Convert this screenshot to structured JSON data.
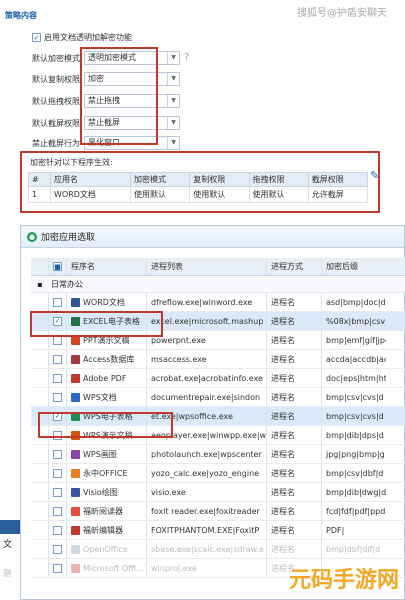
{
  "watermark_top": "搜狐号@护盾安聊天",
  "policy": {
    "section_title": "策略内容",
    "enable_checkbox_label": "启用文档透明加解密功能",
    "fields": [
      {
        "label": "默认加密模式",
        "value": "透明加密模式"
      },
      {
        "label": "默认复制权限",
        "value": "加密"
      },
      {
        "label": "默认拖拽权限",
        "value": "禁止拖拽"
      },
      {
        "label": "默认截屏权限",
        "value": "禁止截屏"
      },
      {
        "label": "禁止截屏行为",
        "value": "黑化窗口"
      }
    ],
    "apply_label": "加密针对以下程序生效:",
    "table": {
      "headers": [
        "#",
        "应用名",
        "加密模式",
        "复制权限",
        "拖拽权限",
        "截屏权限"
      ],
      "rows": [
        [
          "1",
          "WORD文档",
          "使用默认",
          "使用默认",
          "使用默认",
          "允许截屏"
        ]
      ]
    }
  },
  "dialog": {
    "title": "加密应用选取",
    "columns": [
      "程序名",
      "进程列表",
      "进程方式",
      "加密后缀"
    ],
    "group": "日常办公",
    "rows": [
      {
        "checked": false,
        "name": "WORD文档",
        "process": "dfreflow.exe|winword.exe",
        "mode": "进程名",
        "ext": "asd|bmp|doc|do",
        "icon_color": "#2b579a",
        "selected": false,
        "faded": false
      },
      {
        "checked": true,
        "name": "EXCEL电子表格",
        "process": "excel.exe|microsoft.mashup",
        "mode": "进程名",
        "ext": "%08x|bmp|csv|d",
        "icon_color": "#217346",
        "selected": true,
        "faded": false
      },
      {
        "checked": false,
        "name": "PPT演示文稿",
        "process": "powerpnt.exe",
        "mode": "进程名",
        "ext": "bmp|emf|gif|jpe",
        "icon_color": "#d24726",
        "selected": false,
        "faded": false
      },
      {
        "checked": false,
        "name": "Access数据库",
        "process": "msaccess.exe",
        "mode": "进程名",
        "ext": "accda|accdb|ac",
        "icon_color": "#a4373a",
        "selected": false,
        "faded": false
      },
      {
        "checked": false,
        "name": "Adobe PDF",
        "process": "acrobat.exe|acrobatinfo.exe",
        "mode": "进程名",
        "ext": "doc|eps|htm|ht",
        "icon_color": "#c0392b",
        "selected": false,
        "faded": false
      },
      {
        "checked": false,
        "name": "WPS文档",
        "process": "documentrepair.exe|sindon",
        "mode": "进程名",
        "ext": "bmp|csv|cvs|d",
        "icon_color": "#2a66c5",
        "selected": false,
        "faded": false
      },
      {
        "checked": true,
        "name": "WPS电子表格",
        "process": "et.exe|wpsoffice.exe",
        "mode": "进程名",
        "ext": "bmp|csv|cvs|d",
        "icon_color": "#1e8e4e",
        "selected": true,
        "faded": false
      },
      {
        "checked": false,
        "name": "WPS演示文稿",
        "process": "aeoplayer.exe|winwpp.exe|w",
        "mode": "进程名",
        "ext": "bmp|dib|dps|d",
        "icon_color": "#d35400",
        "selected": false,
        "faded": false
      },
      {
        "checked": false,
        "name": "WPS画图",
        "process": "photolaunch.exe|wpscenter",
        "mode": "进程名",
        "ext": "jpg|png|bmp|g",
        "icon_color": "#8e44ad",
        "selected": false,
        "faded": false
      },
      {
        "checked": false,
        "name": "永中OFFICE",
        "process": "yozo_calc.exe|yozo_engine",
        "mode": "进程名",
        "ext": "bmp|csv|dbf|d",
        "icon_color": "#e67e22",
        "selected": false,
        "faded": false
      },
      {
        "checked": false,
        "name": "Visio绘图",
        "process": "visio.exe",
        "mode": "进程名",
        "ext": "bmp|dib|dwg|d",
        "icon_color": "#3955a3",
        "selected": false,
        "faded": false
      },
      {
        "checked": false,
        "name": "福昕阅读器",
        "process": "foxit reader.exe|foxitreader",
        "mode": "进程名",
        "ext": "fcd|fdf|pdf|ppd",
        "icon_color": "#e74c3c",
        "selected": false,
        "faded": false
      },
      {
        "checked": false,
        "name": "福昕编辑器",
        "process": "FOXITPHANTOM.EXE|FoxitP",
        "mode": "进程名",
        "ext": "PDF|",
        "icon_color": "#c0392b",
        "selected": false,
        "faded": false
      },
      {
        "checked": false,
        "name": "OpenOffice",
        "process": "sbase.exe|scalc.exe|sdraw.e",
        "mode": "进程名",
        "ext": "bmp|dbf|dif|d",
        "icon_color": "#cfd8e3",
        "selected": false,
        "faded": true
      },
      {
        "checked": false,
        "name": "Microsoft Offi...",
        "process": "winproj.exe",
        "mode": "进程名",
        "ext": "",
        "icon_color": "#e8b4b0",
        "selected": false,
        "faded": true
      }
    ]
  },
  "left_strip": {
    "t1": "文",
    "t2": "测"
  },
  "logo_watermark": "元码手游网"
}
